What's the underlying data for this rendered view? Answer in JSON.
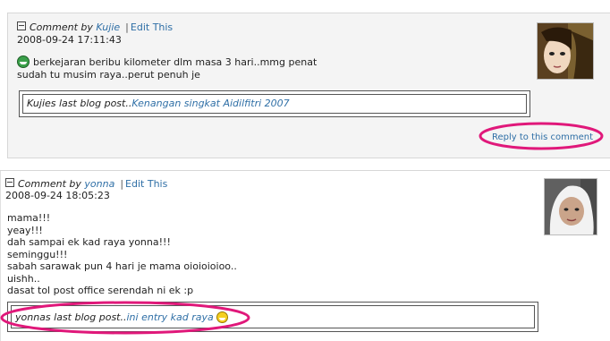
{
  "comments": [
    {
      "prefix": "Comment by",
      "author": "Kujie",
      "edit_label": "Edit This",
      "date": "2008-09-24 17:11:43",
      "lines": [
        "berkejaran beribu kilometer dlm masa 3 hari..mmg penat",
        "sudah tu musim raya..perut penuh je"
      ],
      "last_post_prefix": "Kujies last blog post..",
      "last_post_link": "Kenangan singkat Aidilfitri 2007",
      "reply_label": "Reply to this comment",
      "avatar_icon": "avatar-photo-kujie",
      "leading_smiley": "grin-smiley-icon"
    },
    {
      "prefix": "Comment by",
      "author": "yonna",
      "edit_label": "Edit This",
      "date": "2008-09-24 18:05:23",
      "lines": [
        "mama!!!",
        "yeay!!!",
        "dah sampai ek kad raya yonna!!!",
        "seminggu!!!",
        "sabah sarawak pun 4 hari je mama oioioioioo..",
        "uishh..",
        "dasat tol post office serendah ni ek :p"
      ],
      "last_post_prefix": "yonnas last blog post..",
      "last_post_link": "ini entry kad raya",
      "avatar_icon": "avatar-photo-yonna",
      "trailing_smiley": "smile-smiley-icon"
    }
  ],
  "colors": {
    "link": "#2f6fa6",
    "highlight": "#e0187a",
    "panel_bg": "#f4f4f4"
  }
}
